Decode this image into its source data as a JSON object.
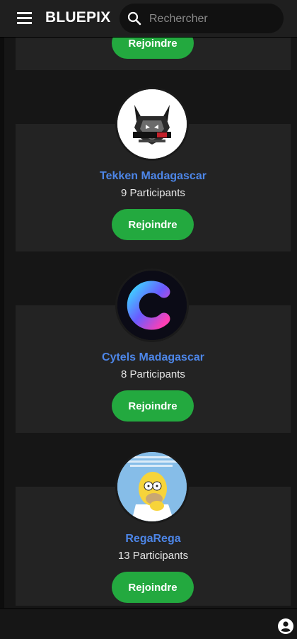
{
  "header": {
    "brand": "BLUEPIX",
    "menu_icon": "hamburger-menu-icon",
    "search": {
      "placeholder": "Rechercher",
      "value": "",
      "icon": "search-icon"
    }
  },
  "groups": [
    {
      "name": "",
      "participants": "",
      "join_label": "Rejoindre",
      "avatar": "partial-card-above"
    },
    {
      "name": "Tekken Madagascar",
      "participants": "9 Participants",
      "join_label": "Rejoindre",
      "avatar": "wolf-logo-avatar"
    },
    {
      "name": "Cytels Madagascar",
      "participants": "8 Participants",
      "join_label": "Rejoindre",
      "avatar": "gradient-c-logo-avatar"
    },
    {
      "name": "RegaRega",
      "participants": "13 Participants",
      "join_label": "Rejoindre",
      "avatar": "cartoon-thinking-avatar"
    }
  ],
  "footer": {
    "account_icon": "account-circle-icon"
  },
  "colors": {
    "background": "#161616",
    "card": "#232323",
    "accent_blue": "#4d86e8",
    "join_green": "#23a93f",
    "topbar": "#1f1f1f"
  }
}
